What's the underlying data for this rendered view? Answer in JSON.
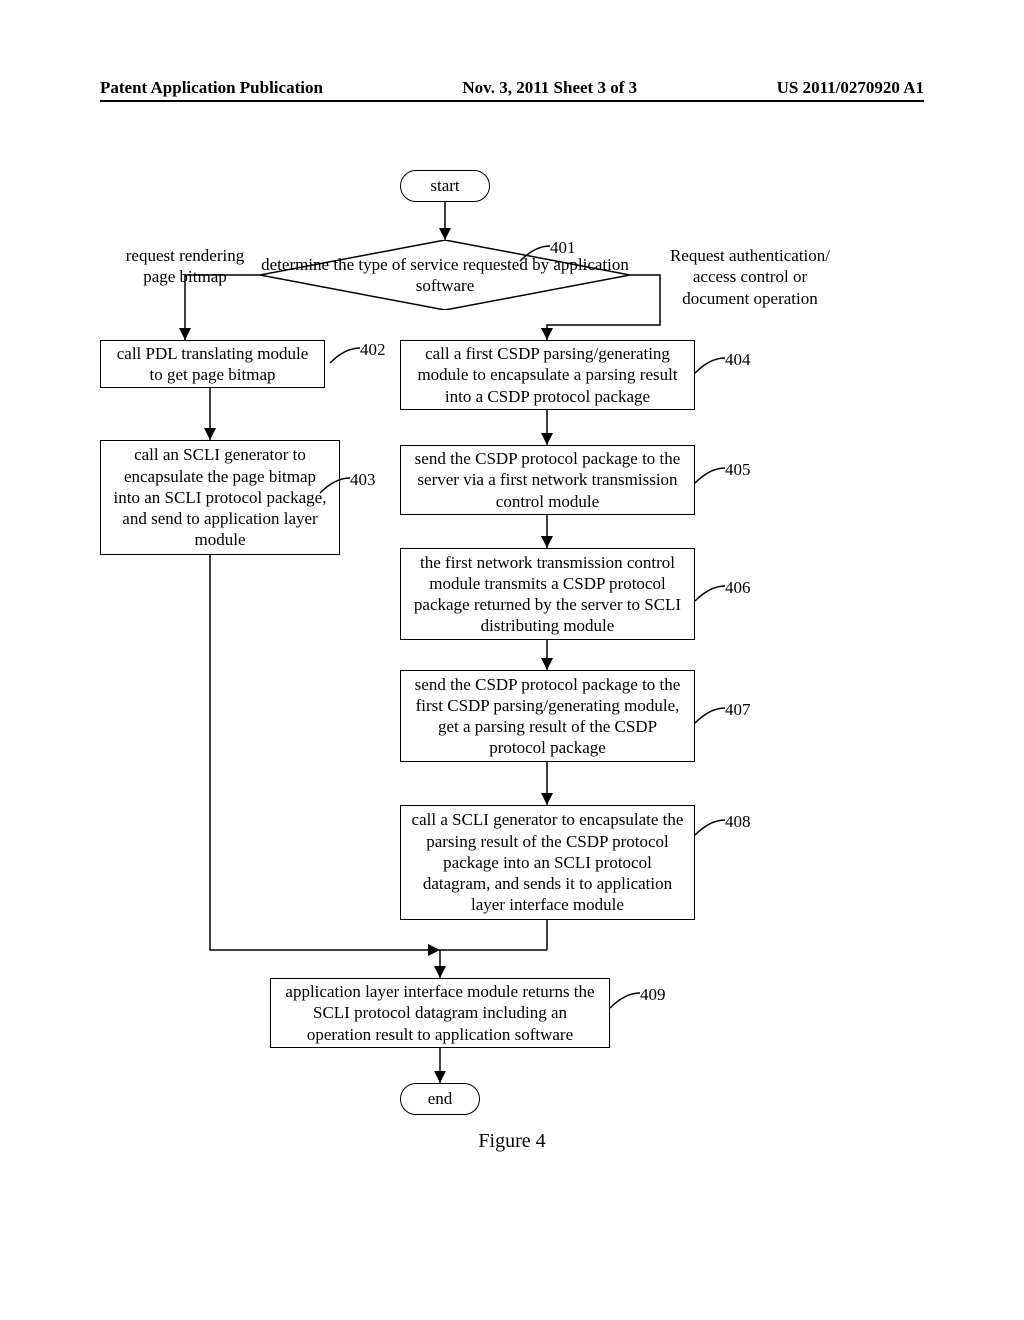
{
  "header": {
    "left": "Patent Application Publication",
    "center": "Nov. 3, 2011   Sheet 3 of 3",
    "right": "US 2011/0270920 A1"
  },
  "terminators": {
    "start": "start",
    "end": "end"
  },
  "decision": {
    "text": "determine the type of service requested by application software"
  },
  "branches": {
    "left": "request rendering page bitmap",
    "right": "Request authentication/ access control or document operation"
  },
  "boxes": {
    "b402": "call PDL translating module to get page bitmap",
    "b403": "call an SCLI generator to encapsulate the page bitmap into an SCLI protocol package, and send to application layer module",
    "b404": "call a first CSDP parsing/generating module to encapsulate a parsing result into a CSDP protocol package",
    "b405": "send the CSDP protocol package to the server via a first network transmission control module",
    "b406": "the first network transmission control module transmits a CSDP protocol package returned by the server to SCLI distributing module",
    "b407": "send the CSDP protocol package to the first CSDP parsing/generating module, get a parsing result of the CSDP protocol package",
    "b408": "call a SCLI generator to encapsulate the parsing result of the CSDP protocol package into an SCLI protocol datagram, and sends it to application layer interface module",
    "b409": "application layer interface module returns the SCLI protocol datagram including an operation result to application software"
  },
  "refs": {
    "r401": "401",
    "r402": "402",
    "r403": "403",
    "r404": "404",
    "r405": "405",
    "r406": "406",
    "r407": "407",
    "r408": "408",
    "r409": "409"
  },
  "figure_caption": "Figure 4"
}
